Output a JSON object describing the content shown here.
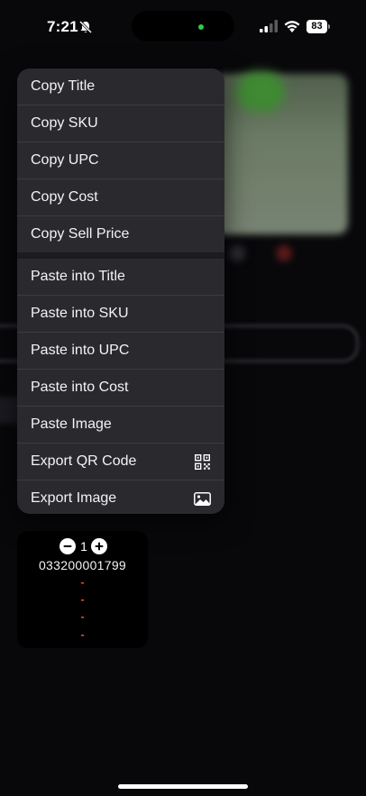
{
  "status": {
    "time": "7:21",
    "battery": "83"
  },
  "menu": {
    "copy_items": [
      {
        "label": "Copy Title"
      },
      {
        "label": "Copy SKU"
      },
      {
        "label": "Copy UPC"
      },
      {
        "label": "Copy Cost"
      },
      {
        "label": "Copy Sell Price"
      }
    ],
    "action_items": [
      {
        "label": "Paste into Title"
      },
      {
        "label": "Paste into SKU"
      },
      {
        "label": "Paste into UPC"
      },
      {
        "label": "Paste into Cost"
      },
      {
        "label": "Paste Image"
      },
      {
        "label": "Export QR Code",
        "icon": "qr-code-icon"
      },
      {
        "label": "Export Image",
        "icon": "photo-icon"
      }
    ]
  },
  "card": {
    "quantity": "1",
    "upc": "033200001799",
    "fields": [
      "-",
      "-",
      "-",
      "-"
    ]
  },
  "colors": {
    "accent_red": "#ff3b30",
    "menu_bg": "#2a2a2e"
  }
}
